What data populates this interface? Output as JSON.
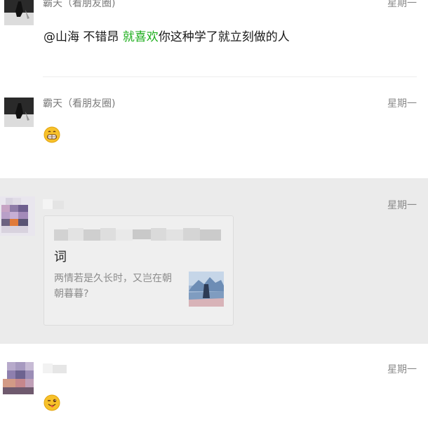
{
  "messages": [
    {
      "name": "霸天（看朋友圈)",
      "time": "星期一",
      "content_prefix": "@山海  不错昂 ",
      "content_highlight": "就喜欢",
      "content_suffix": "你这种学了就立刻做的人"
    },
    {
      "name": "霸天（看朋友圈)",
      "time": "星期一",
      "emoji": "grinning-face-icon"
    },
    {
      "name": "",
      "time": "星期一",
      "card": {
        "title_line2": "词",
        "description": "两情若是久长时，又岂在朝朝暮暮?"
      }
    },
    {
      "name": "",
      "time": "星期一",
      "emoji": "winking-face-tongue-icon"
    }
  ],
  "colors": {
    "highlight": "#1aad19",
    "read_row_background": "#ebebeb"
  }
}
